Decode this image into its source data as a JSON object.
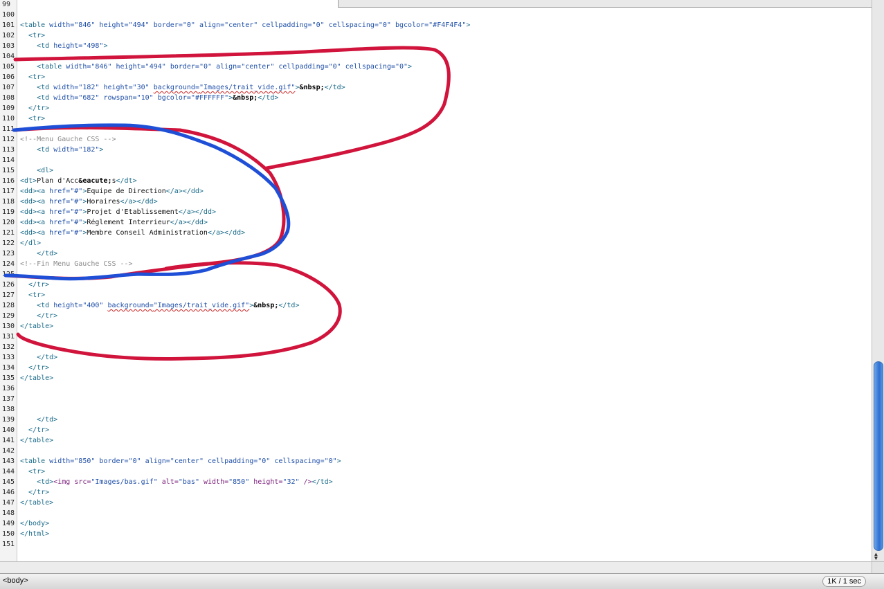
{
  "editor": {
    "lines": [
      {
        "n": "99",
        "html": ""
      },
      {
        "n": "100",
        "html": ""
      },
      {
        "n": "101",
        "html": "<span class=\"tag\">&lt;table</span> <span class=\"attr\">width=</span><span class=\"val\">\"846\"</span> <span class=\"attr\">height=</span><span class=\"val\">\"494\"</span> <span class=\"attr\">border=</span><span class=\"val\">\"0\"</span> <span class=\"attr\">align=</span><span class=\"val\">\"center\"</span> <span class=\"attr\">cellpadding=</span><span class=\"val\">\"0\"</span> <span class=\"attr\">cellspacing=</span><span class=\"val\">\"0\"</span> <span class=\"attr\">bgcolor=</span><span class=\"val\">\"#F4F4F4\"</span><span class=\"tag\">&gt;</span>"
      },
      {
        "n": "102",
        "html": "  <span class=\"tag\">&lt;tr&gt;</span>"
      },
      {
        "n": "103",
        "html": "    <span class=\"tag\">&lt;td</span> <span class=\"attr\">height=</span><span class=\"val\">\"498\"</span><span class=\"tag\">&gt;</span>"
      },
      {
        "n": "104",
        "html": ""
      },
      {
        "n": "105",
        "html": "    <span class=\"tag\">&lt;table</span> <span class=\"attr\">width=</span><span class=\"val\">\"846\"</span> <span class=\"attr\">height=</span><span class=\"val\">\"494\"</span> <span class=\"attr\">border=</span><span class=\"val\">\"0\"</span> <span class=\"attr\">align=</span><span class=\"val\">\"center\"</span> <span class=\"attr\">cellpadding=</span><span class=\"val\">\"0\"</span> <span class=\"attr\">cellspacing=</span><span class=\"val\">\"0\"</span><span class=\"tag\">&gt;</span>"
      },
      {
        "n": "106",
        "html": "  <span class=\"tag\">&lt;tr&gt;</span>"
      },
      {
        "n": "107",
        "html": "    <span class=\"tag\">&lt;td</span> <span class=\"attr\">width=</span><span class=\"val\">\"182\"</span> <span class=\"attr\">height=</span><span class=\"val\">\"30\"</span> <span class=\"attr squig\">background=</span><span class=\"val squig\">\"Images/trait_vide.gif\"</span><span class=\"tag\">&gt;</span><span class=\"ent\">&amp;nbsp;</span><span class=\"tag\">&lt;/td&gt;</span>"
      },
      {
        "n": "108",
        "html": "    <span class=\"tag\">&lt;td</span> <span class=\"attr\">width=</span><span class=\"val\">\"682\"</span> <span class=\"attr\">rowspan=</span><span class=\"val\">\"10\"</span> <span class=\"attr\">bgcolor=</span><span class=\"val\">\"#FFFFFF\"</span><span class=\"tag\">&gt;</span><span class=\"ent\">&amp;nbsp;</span><span class=\"tag\">&lt;/td&gt;</span>"
      },
      {
        "n": "109",
        "html": "  <span class=\"tag\">&lt;/tr&gt;</span>"
      },
      {
        "n": "110",
        "html": "  <span class=\"tag\">&lt;tr&gt;</span>"
      },
      {
        "n": "111",
        "html": ""
      },
      {
        "n": "112",
        "html": "<span class=\"cmt\">&lt;!--Menu Gauche CSS --&gt;</span>"
      },
      {
        "n": "113",
        "html": "    <span class=\"tag\">&lt;td</span> <span class=\"attr\">width=</span><span class=\"val\">\"182\"</span><span class=\"tag\">&gt;</span>"
      },
      {
        "n": "114",
        "html": ""
      },
      {
        "n": "115",
        "html": "    <span class=\"tag\">&lt;dl&gt;</span>"
      },
      {
        "n": "116",
        "html": "<span class=\"tag\">&lt;dt&gt;</span><span class=\"txt\">Plan d'Acc</span><span class=\"ent\">&amp;eacute;</span><span class=\"txt\">s</span><span class=\"tag\">&lt;/dt&gt;</span>"
      },
      {
        "n": "117",
        "html": "<span class=\"tag\">&lt;dd&gt;&lt;a</span> <span class=\"attr\">href=</span><span class=\"val\">\"#\"</span><span class=\"tag\">&gt;</span><span class=\"txt\">Equipe de Direction</span><span class=\"tag\">&lt;/a&gt;&lt;/dd&gt;</span>"
      },
      {
        "n": "118",
        "html": "<span class=\"tag\">&lt;dd&gt;&lt;a</span> <span class=\"attr\">href=</span><span class=\"val\">\"#\"</span><span class=\"tag\">&gt;</span><span class=\"txt\">Horaires</span><span class=\"tag\">&lt;/a&gt;&lt;/dd&gt;</span>"
      },
      {
        "n": "119",
        "html": "<span class=\"tag\">&lt;dd&gt;&lt;a</span> <span class=\"attr\">href=</span><span class=\"val\">\"#\"</span><span class=\"tag\">&gt;</span><span class=\"txt\">Projet d'Etablissement</span><span class=\"tag\">&lt;/a&gt;&lt;/dd&gt;</span>"
      },
      {
        "n": "120",
        "html": "<span class=\"tag\">&lt;dd&gt;&lt;a</span> <span class=\"attr\">href=</span><span class=\"val\">\"#\"</span><span class=\"tag\">&gt;</span><span class=\"txt\">Réglement Interrieur</span><span class=\"tag\">&lt;/a&gt;&lt;/dd&gt;</span>"
      },
      {
        "n": "121",
        "html": "<span class=\"tag\">&lt;dd&gt;&lt;a</span> <span class=\"attr\">href=</span><span class=\"val\">\"#\"</span><span class=\"tag\">&gt;</span><span class=\"txt\">Membre Conseil Administration</span><span class=\"tag\">&lt;/a&gt;&lt;/dd&gt;</span>"
      },
      {
        "n": "122",
        "html": "<span class=\"tag\">&lt;/dl&gt;</span>"
      },
      {
        "n": "123",
        "html": "    <span class=\"tag\">&lt;/td&gt;</span>"
      },
      {
        "n": "124",
        "html": "<span class=\"cmt\">&lt;!--Fin Menu Gauche CSS --&gt;</span>"
      },
      {
        "n": "125",
        "html": ""
      },
      {
        "n": "126",
        "html": "  <span class=\"tag\">&lt;/tr&gt;</span>"
      },
      {
        "n": "127",
        "html": "  <span class=\"tag\">&lt;tr&gt;</span>"
      },
      {
        "n": "128",
        "html": "    <span class=\"tag\">&lt;td</span> <span class=\"attr\">height=</span><span class=\"val\">\"400\"</span> <span class=\"attr squig\">background=</span><span class=\"val squig\">\"Images/trait_vide.gif\"</span><span class=\"tag\">&gt;</span><span class=\"ent\">&amp;nbsp;</span><span class=\"tag\">&lt;/td&gt;</span>"
      },
      {
        "n": "129",
        "html": "    <span class=\"tag\">&lt;/tr&gt;</span>"
      },
      {
        "n": "130",
        "html": "<span class=\"tag\">&lt;/table&gt;</span>"
      },
      {
        "n": "131",
        "html": ""
      },
      {
        "n": "132",
        "html": ""
      },
      {
        "n": "133",
        "html": "    <span class=\"tag\">&lt;/td&gt;</span>"
      },
      {
        "n": "134",
        "html": "  <span class=\"tag\">&lt;/tr&gt;</span>"
      },
      {
        "n": "135",
        "html": "<span class=\"tag\">&lt;/table&gt;</span>"
      },
      {
        "n": "136",
        "html": ""
      },
      {
        "n": "137",
        "html": ""
      },
      {
        "n": "138",
        "html": ""
      },
      {
        "n": "139",
        "html": "    <span class=\"tag\">&lt;/td&gt;</span>"
      },
      {
        "n": "140",
        "html": "  <span class=\"tag\">&lt;/tr&gt;</span>"
      },
      {
        "n": "141",
        "html": "<span class=\"tag\">&lt;/table&gt;</span>"
      },
      {
        "n": "142",
        "html": ""
      },
      {
        "n": "143",
        "html": "<span class=\"tag\">&lt;table</span> <span class=\"attr\">width=</span><span class=\"val\">\"850\"</span> <span class=\"attr\">border=</span><span class=\"val\">\"0\"</span> <span class=\"attr\">align=</span><span class=\"val\">\"center\"</span> <span class=\"attr\">cellpadding=</span><span class=\"val\">\"0\"</span> <span class=\"attr\">cellspacing=</span><span class=\"val\">\"0\"</span><span class=\"tag\">&gt;</span>"
      },
      {
        "n": "144",
        "html": "  <span class=\"tag\">&lt;tr&gt;</span>"
      },
      {
        "n": "145",
        "html": "    <span class=\"tag\">&lt;td&gt;</span><span class=\"img\">&lt;img</span> <span class=\"img\">src=</span><span class=\"val\">\"Images/bas.gif\"</span> <span class=\"img\">alt=</span><span class=\"val\">\"bas\"</span> <span class=\"img\">width=</span><span class=\"val\">\"850\"</span> <span class=\"img\">height=</span><span class=\"val\">\"32\"</span> <span class=\"img\">/&gt;</span><span class=\"tag\">&lt;/td&gt;</span>"
      },
      {
        "n": "146",
        "html": "  <span class=\"tag\">&lt;/tr&gt;</span>"
      },
      {
        "n": "147",
        "html": "<span class=\"tag\">&lt;/table&gt;</span>"
      },
      {
        "n": "148",
        "html": ""
      },
      {
        "n": "149",
        "html": "<span class=\"tag\">&lt;/body&gt;</span>"
      },
      {
        "n": "150",
        "html": "<span class=\"tag\">&lt;/html&gt;</span>"
      },
      {
        "n": "151",
        "html": ""
      }
    ]
  },
  "status": {
    "tag_selector": "<body>",
    "size_info": "1K / 1 sec"
  },
  "colors": {
    "red_annotation": "#d0143c",
    "blue_annotation": "#1e4fd6"
  },
  "icons": {
    "scroll_up": "scroll-up-arrow-icon",
    "scroll_down": "scroll-down-arrow-icon"
  }
}
